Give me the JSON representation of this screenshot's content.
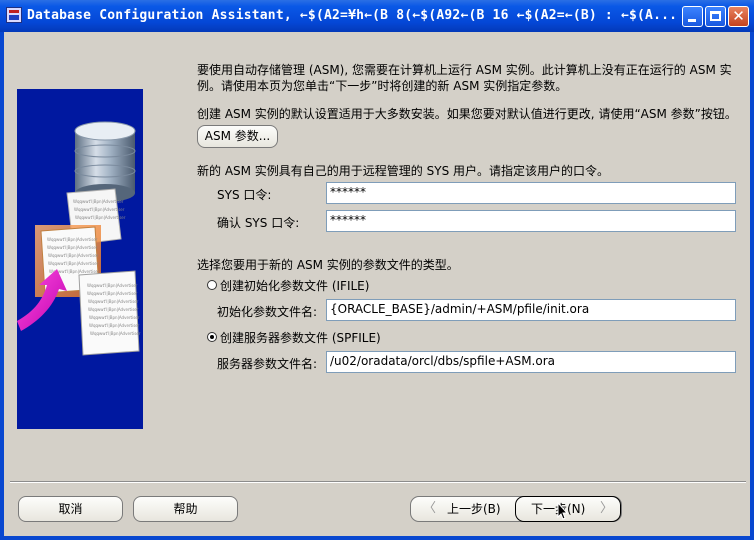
{
  "window": {
    "title": "Database Configuration Assistant, ←$(A2=¥h←(B 8(←$(A92←(B 16 ←$(A2=←(B) : ←$(A..."
  },
  "intro": {
    "line1": "要使用自动存储管理 (ASM), 您需要在计算机上运行 ASM 实例。此计算机上没有正在运行的 ASM 实",
    "line2": "例。请使用本页为您单击“下一步”时将创建的新 ASM 实例指定参数。"
  },
  "defaults_note": "创建 ASM 实例的默认设置适用于大多数安装。如果您要对默认值进行更改, 请使用“ASM 参数”按钮。",
  "asm_params_button": "ASM 参数...",
  "sys_note": "新的 ASM 实例具有自己的用于远程管理的 SYS 用户。请指定该用户的口令。",
  "sys_password": {
    "label": "SYS 口令:",
    "value": "******"
  },
  "confirm_password": {
    "label": "确认 SYS 口令:",
    "value": "******"
  },
  "param_file_note": "选择您要用于新的 ASM 实例的参数文件的类型。",
  "ifile": {
    "radio_label": "创建初始化参数文件 (IFILE)",
    "field_label": "初始化参数文件名:",
    "value": "{ORACLE_BASE}/admin/+ASM/pfile/init.ora",
    "selected": false
  },
  "spfile": {
    "radio_label": "创建服务器参数文件 (SPFILE)",
    "field_label": "服务器参数文件名:",
    "value": "/u02/oradata/orcl/dbs/spfile+ASM.ora",
    "selected": true
  },
  "footer": {
    "cancel": "取消",
    "help": "帮助",
    "back": "上一步(B)",
    "next": "下一步(N)"
  },
  "illustration": {
    "doc_text": "Wqqwwt'l|Bpn|Advertiser"
  }
}
